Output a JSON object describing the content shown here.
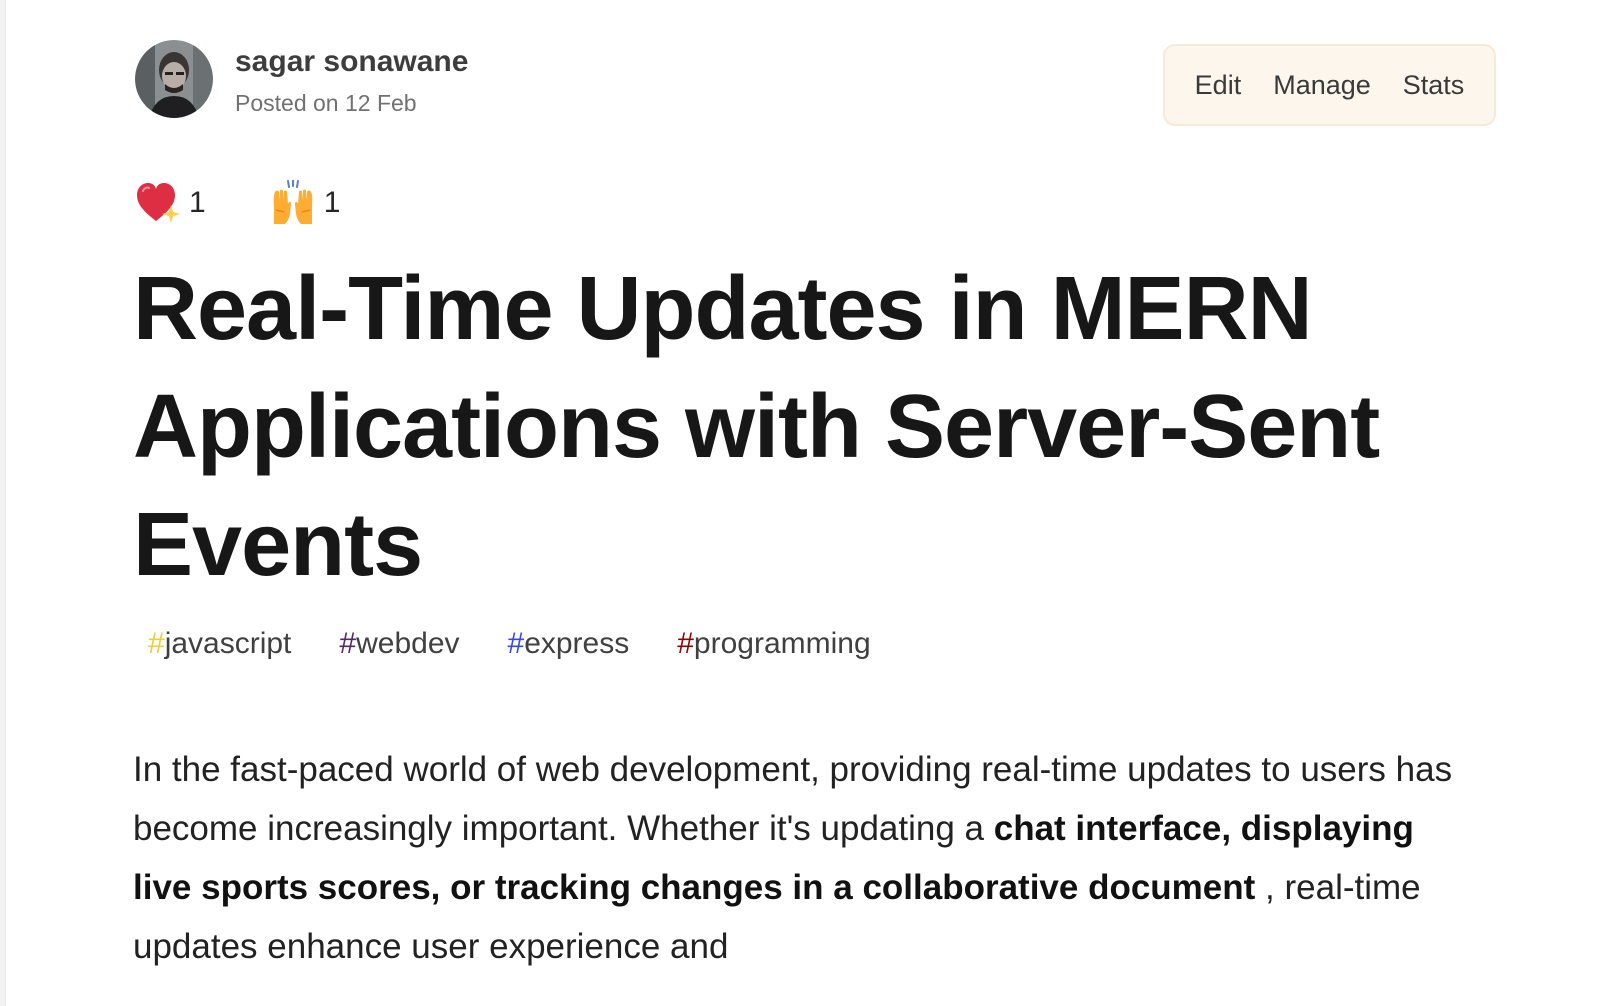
{
  "author": {
    "name": "sagar sonawane",
    "posted": "Posted on 12 Feb"
  },
  "actions": {
    "edit_label": "Edit",
    "manage_label": "Manage",
    "stats_label": "Stats"
  },
  "reactions": [
    {
      "icon": "sparkle-heart-icon",
      "count": "1"
    },
    {
      "icon": "raised-hands-icon",
      "count": "1"
    }
  ],
  "title": "Real-Time Updates in MERN Applications with Server-Sent Events",
  "tags": [
    {
      "hash": "#",
      "label": "javascript",
      "hash_color": "#e8cf3c"
    },
    {
      "hash": "#",
      "label": "webdev",
      "hash_color": "#562765"
    },
    {
      "hash": "#",
      "label": "express",
      "hash_color": "#3b49df"
    },
    {
      "hash": "#",
      "label": "programming",
      "hash_color": "#890606"
    }
  ],
  "body": {
    "intro": "In the fast-paced world of web development, providing real-time updates to users has become increasingly important. Whether it's updating a ",
    "bold": "chat interface, displaying live sports scores, or tracking changes in a collaborative document",
    "outro": " , real-time updates enhance user experience and"
  },
  "colors": {
    "action_box_bg": "#fcf6ec",
    "title": "#171717"
  }
}
